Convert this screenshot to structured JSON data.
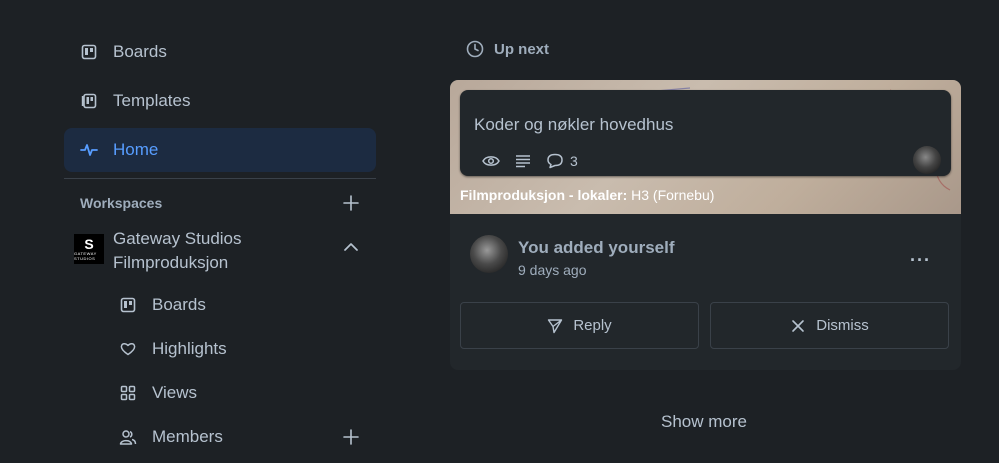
{
  "sidebar": {
    "items": [
      {
        "label": "Boards"
      },
      {
        "label": "Templates"
      },
      {
        "label": "Home"
      }
    ],
    "workspaces_label": "Workspaces",
    "workspace": {
      "name_line1": "Gateway Studios",
      "name_line2": "Filmproduksjon",
      "logo_letter": "S",
      "logo_text": "GATEWAY STUDIOS"
    },
    "sub_items": [
      {
        "label": "Boards"
      },
      {
        "label": "Highlights"
      },
      {
        "label": "Views"
      },
      {
        "label": "Members"
      }
    ]
  },
  "upnext": {
    "label": "Up next"
  },
  "card": {
    "title": "Koder og nøkler hovedhus",
    "comment_count": "3",
    "board_name": "Filmproduksjon - lokaler:",
    "list_name": " H3 (Fornebu)"
  },
  "activity": {
    "title": "You added yourself",
    "time": "9 days ago",
    "more": "···"
  },
  "actions": {
    "reply": "Reply",
    "dismiss": "Dismiss"
  },
  "show_more": "Show more",
  "colors": {
    "background": "#1d2125",
    "active_nav_bg": "#1c2b41",
    "accent": "#579dff",
    "text": "#b6c2cf"
  }
}
